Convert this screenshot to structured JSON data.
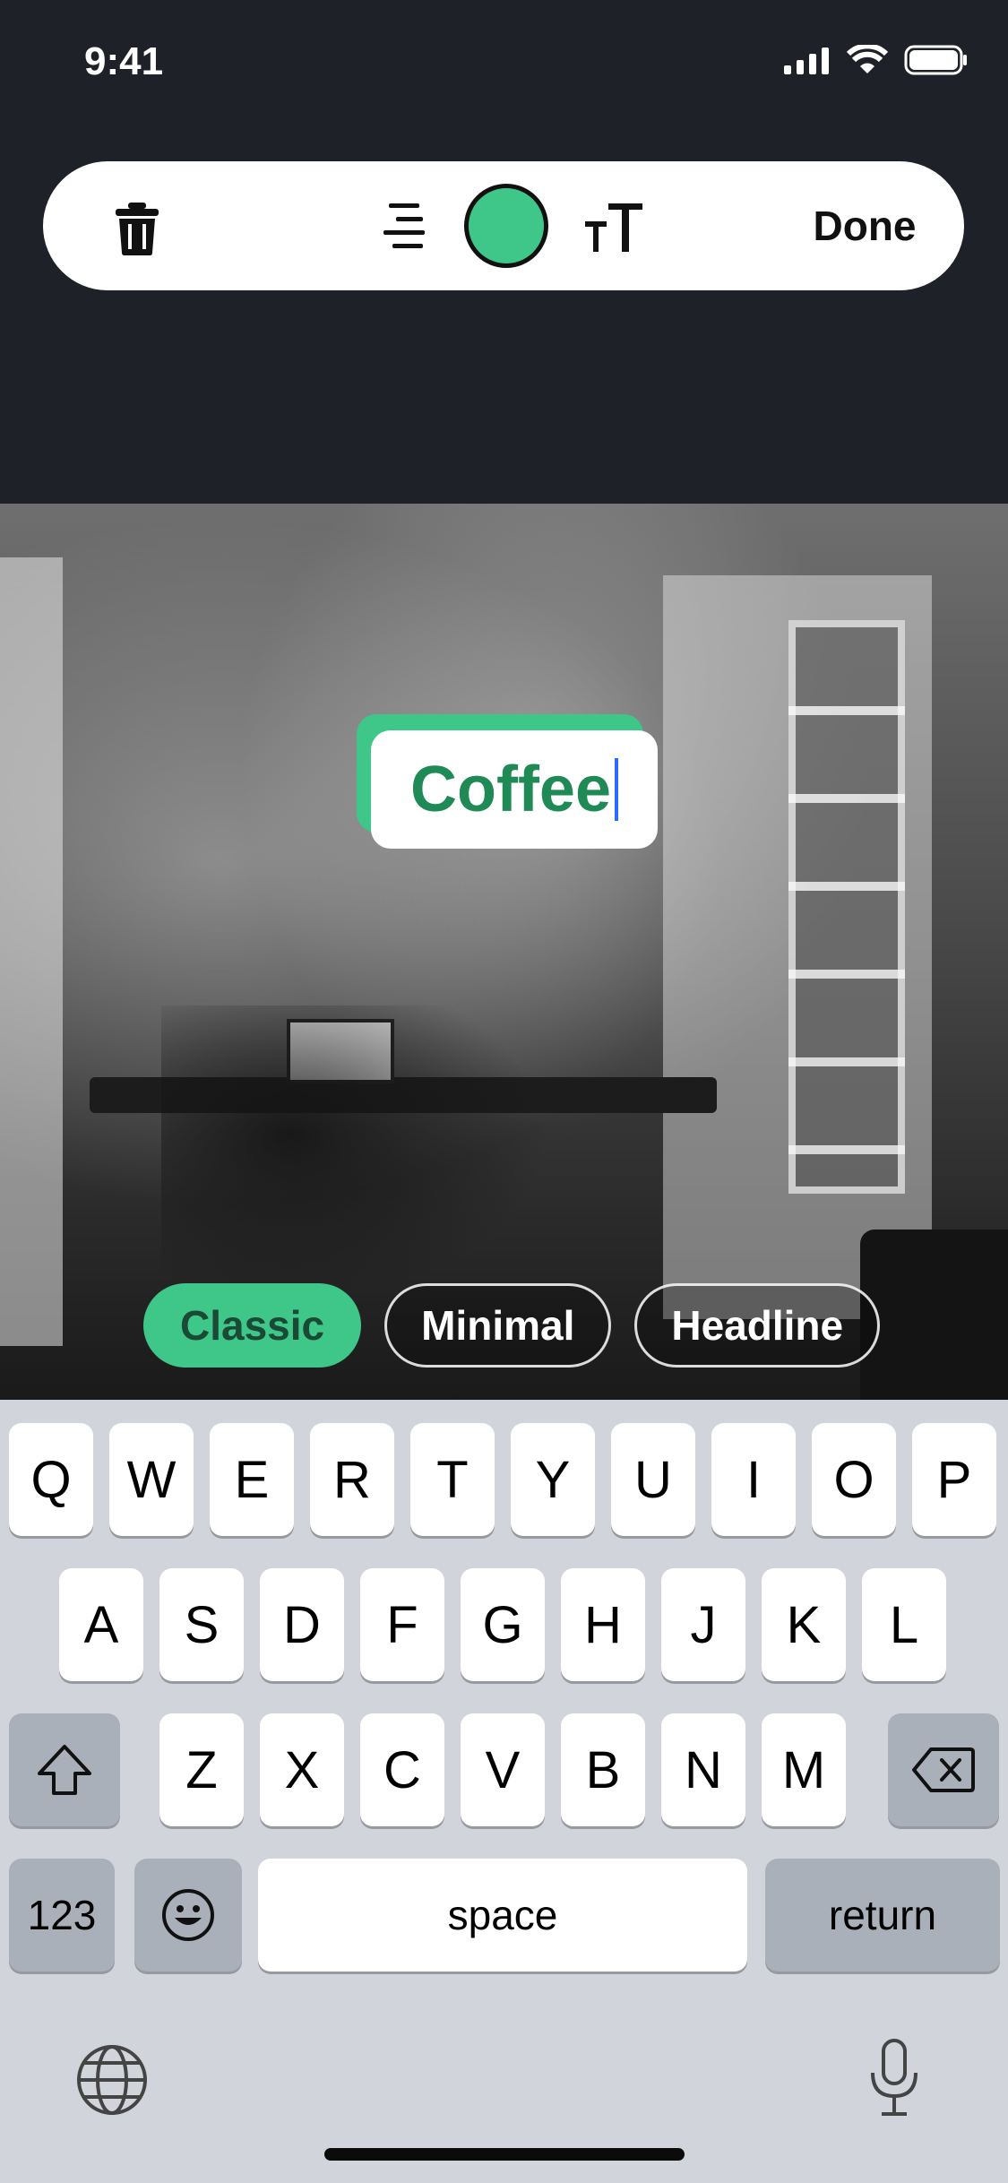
{
  "status_bar": {
    "time": "9:41"
  },
  "toolbar": {
    "done_label": "Done"
  },
  "text_color": "#3fc78a",
  "caption": {
    "text": "Coffee"
  },
  "style_options": [
    {
      "label": "Classic",
      "selected": true
    },
    {
      "label": "Minimal",
      "selected": false
    },
    {
      "label": "Headline",
      "selected": false
    }
  ],
  "keyboard": {
    "row1": [
      "Q",
      "W",
      "E",
      "R",
      "T",
      "Y",
      "U",
      "I",
      "O",
      "P"
    ],
    "row2": [
      "A",
      "S",
      "D",
      "F",
      "G",
      "H",
      "J",
      "K",
      "L"
    ],
    "row3": [
      "Z",
      "X",
      "C",
      "V",
      "B",
      "N",
      "M"
    ],
    "numbers_label": "123",
    "space_label": "space",
    "return_label": "return"
  }
}
